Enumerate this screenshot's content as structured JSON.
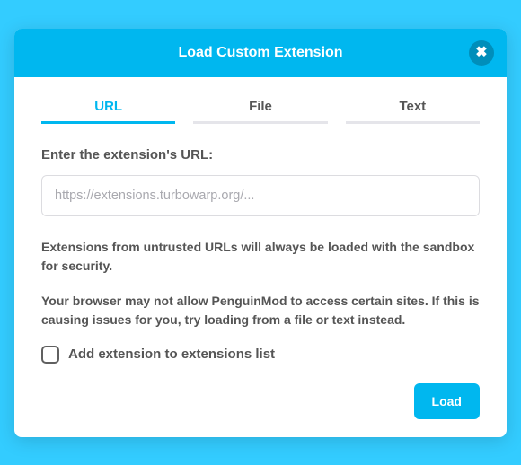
{
  "header": {
    "title": "Load Custom Extension"
  },
  "tabs": {
    "url": "URL",
    "file": "File",
    "text": "Text"
  },
  "form": {
    "label": "Enter the extension's URL:",
    "url_placeholder": "https://extensions.turbowarp.org/...",
    "url_value": ""
  },
  "notes": {
    "sandbox": "Extensions from untrusted URLs will always be loaded with the sandbox for security.",
    "browser": "Your browser may not allow PenguinMod to access certain sites. If this is causing issues for you, try loading from a file or text instead."
  },
  "checkbox": {
    "label": "Add extension to extensions list",
    "checked": false
  },
  "buttons": {
    "load": "Load"
  },
  "colors": {
    "accent": "#00b7ef"
  }
}
